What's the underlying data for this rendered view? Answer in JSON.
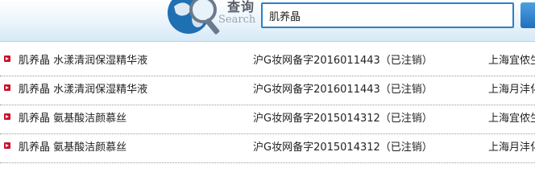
{
  "header": {
    "logo_title": "查询",
    "logo_sub": "Search",
    "search_value": "肌养晶"
  },
  "rows": [
    {
      "name": "肌养晶 水漾清润保湿精华液",
      "record": "沪G妆网备字2016011443（已注销）",
      "company": "上海宜侬生"
    },
    {
      "name": "肌养晶 水漾清润保湿精华液",
      "record": "沪G妆网备字2016011443（已注销）",
      "company": "上海月沣化"
    },
    {
      "name": "肌养晶 氨基酸洁颜慕丝",
      "record": "沪G妆网备字2015014312（已注销）",
      "company": "上海宜侬生"
    },
    {
      "name": "肌养晶 氨基酸洁颜慕丝",
      "record": "沪G妆网备字2015014312（已注销）",
      "company": "上海月沣化"
    }
  ]
}
